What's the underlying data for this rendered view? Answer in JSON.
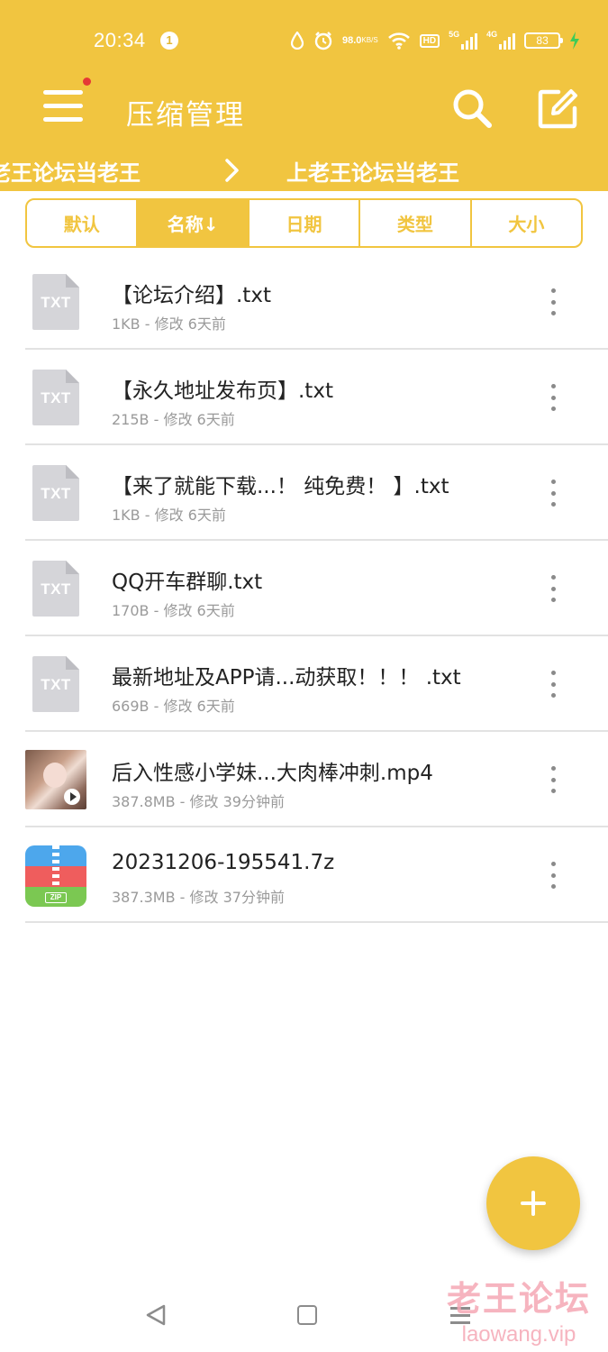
{
  "status_bar": {
    "time": "20:34",
    "notification_count": "1",
    "net_speed": "98.0",
    "net_speed_unit": "KB/S",
    "hd_label": "HD",
    "sim1_label": "5G",
    "sim2_label": "4G",
    "battery": "83"
  },
  "app_bar": {
    "title": "压缩管理",
    "icons": [
      "menu-icon",
      "search-icon",
      "edit-icon"
    ]
  },
  "breadcrumb": {
    "items": [
      "老王论坛当老王",
      "上老王论坛当老王"
    ]
  },
  "sort_tabs": [
    {
      "label": "默认",
      "active": false
    },
    {
      "label": "名称↓",
      "active": true
    },
    {
      "label": "日期",
      "active": false
    },
    {
      "label": "类型",
      "active": false
    },
    {
      "label": "大小",
      "active": false
    }
  ],
  "files": [
    {
      "name": "【论坛介绍】.txt",
      "meta": "1KB - 修改 6天前",
      "icon": "txt-file-icon",
      "icon_label": "TXT"
    },
    {
      "name": "【永久地址发布页】.txt",
      "meta": "215B - 修改 6天前",
      "icon": "txt-file-icon",
      "icon_label": "TXT"
    },
    {
      "name": "【来了就能下载...！ 纯免费！ 】.txt",
      "meta": "1KB - 修改 6天前",
      "icon": "txt-file-icon",
      "icon_label": "TXT"
    },
    {
      "name": "QQ开车群聊.txt",
      "meta": "170B - 修改 6天前",
      "icon": "txt-file-icon",
      "icon_label": "TXT"
    },
    {
      "name": "最新地址及APP请...动获取！！！ .txt",
      "meta": "669B - 修改 6天前",
      "icon": "txt-file-icon",
      "icon_label": "TXT"
    },
    {
      "name": "后入性感小学妹...大肉棒冲刺.mp4",
      "meta": "387.8MB - 修改 39分钟前",
      "icon": "video-thumbnail-icon"
    },
    {
      "name": "20231206-195541.7z",
      "meta": "387.3MB - 修改 37分钟前",
      "icon": "zip-archive-icon",
      "icon_label": "ZIP"
    }
  ],
  "fab": {
    "icon": "plus-icon"
  },
  "nav_bar": {
    "icons": [
      "back-icon",
      "home-icon",
      "recents-icon"
    ]
  },
  "watermark": {
    "title": "老王论坛",
    "url": "laowang.vip"
  },
  "colors": {
    "accent": "#f1c540",
    "divider": "#e2e2e2",
    "meta_text": "#9a9a9a"
  }
}
